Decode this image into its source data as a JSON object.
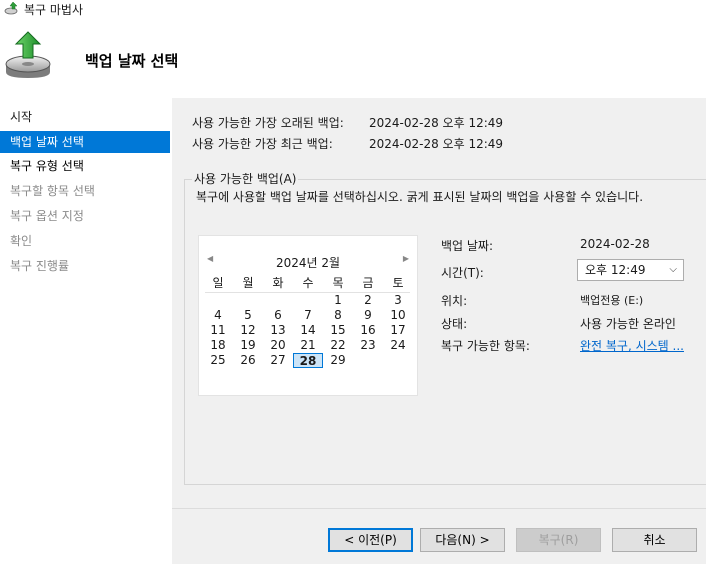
{
  "window": {
    "title": "복구 마법사"
  },
  "header": {
    "title": "백업 날짜 선택"
  },
  "nav": {
    "items": [
      {
        "label": "시작",
        "state": "normal"
      },
      {
        "label": "백업 날짜 선택",
        "state": "active"
      },
      {
        "label": "복구 유형 선택",
        "state": "bold"
      },
      {
        "label": "복구할 항목 선택",
        "state": "dim"
      },
      {
        "label": "복구 옵션 지정",
        "state": "dim"
      },
      {
        "label": "확인",
        "state": "dim"
      },
      {
        "label": "복구 진행률",
        "state": "dim"
      }
    ]
  },
  "info": {
    "oldest_label": "사용 가능한 가장 오래된 백업:",
    "oldest_value": "2024-02-28 오후 12:49",
    "latest_label": "사용 가능한 가장 최근 백업:",
    "latest_value": "2024-02-28 오후 12:49"
  },
  "group": {
    "title": "사용 가능한 백업(A)",
    "instruction": "복구에 사용할 백업 날짜를 선택하십시오. 굵게 표시된 날짜의 백업을 사용할 수 있습니다."
  },
  "calendar": {
    "month": "2024년 2월",
    "weekdays": [
      "일",
      "월",
      "화",
      "수",
      "목",
      "금",
      "토"
    ],
    "weeks": [
      [
        "",
        "",
        "",
        "",
        "1",
        "2",
        "3"
      ],
      [
        "4",
        "5",
        "6",
        "7",
        "8",
        "9",
        "10"
      ],
      [
        "11",
        "12",
        "13",
        "14",
        "15",
        "16",
        "17"
      ],
      [
        "18",
        "19",
        "20",
        "21",
        "22",
        "23",
        "24"
      ],
      [
        "25",
        "26",
        "27",
        "28",
        "29",
        "",
        ""
      ]
    ],
    "selected": "28"
  },
  "details": {
    "date_label": "백업 날짜:",
    "date_value": "2024-02-28",
    "time_label": "시간(T):",
    "time_value": "오후 12:49",
    "location_label": "위치:",
    "location_value": "백업전용 (E:)",
    "status_label": "상태:",
    "status_value": "사용 가능한 온라인",
    "items_label": "복구 가능한 항목:",
    "items_value": "완전 복구, 시스템 ..."
  },
  "buttons": {
    "back": "< 이전(P)",
    "next": "다음(N) >",
    "recover": "복구(R)",
    "cancel": "취소"
  }
}
